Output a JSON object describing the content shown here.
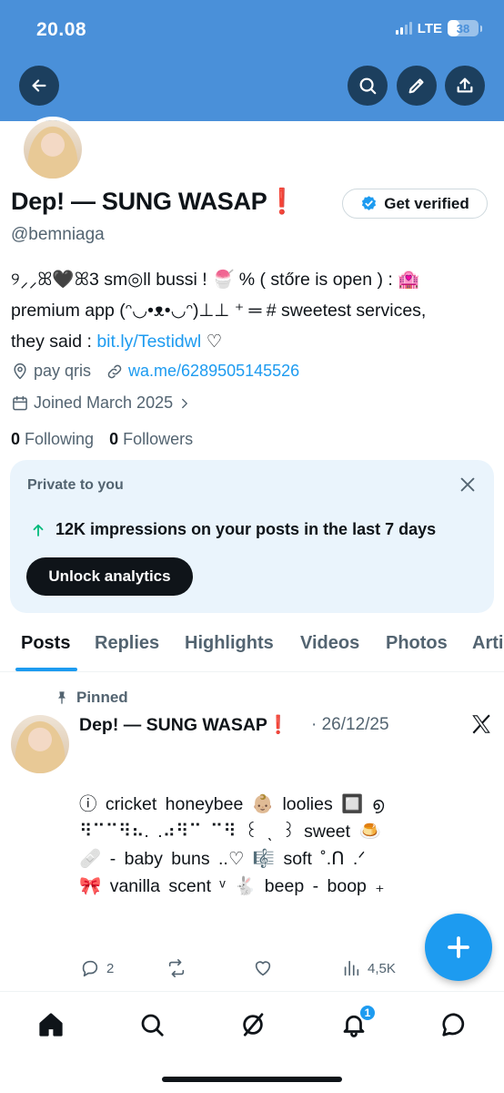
{
  "status_bar": {
    "time": "20.08",
    "network": "LTE",
    "battery_percent": "38",
    "battery_level": 0.38
  },
  "profile": {
    "display_name": "Dep! — SUNG WASAP❗",
    "handle": "@bemniaga",
    "verify_label": "Get verified",
    "bio_line1": "୨⸝⸝ꕤ🖤ꕤ3  sm◎ll bussi ! 🍧 %  ( stőre is open ) : 🏩",
    "bio_line2": "premium app (ᵔ◡•ᴥ•◡ᵔ)⊥⊥  ⁺ ═  # sweetest services,",
    "bio_line3_prefix": "they said : ",
    "bio_link": "bit.ly/Testidwl",
    "bio_line3_suffix": " ♡",
    "location": "pay qris",
    "website": "wa.me/6289505145526",
    "joined": "Joined March 2025",
    "following_count": "0",
    "following_label": "Following",
    "followers_count": "0",
    "followers_label": "Followers"
  },
  "private_card": {
    "title": "Private to you",
    "stat_text": "12K impressions on your posts in the last 7 days",
    "button_label": "Unlock analytics"
  },
  "tabs": [
    "Posts",
    "Replies",
    "Highlights",
    "Videos",
    "Photos",
    "Arti"
  ],
  "post": {
    "pinned_label": "Pinned",
    "author": "Dep! — SUNG WASAP❗",
    "date": "· 26/12/25",
    "line1": "ⓘ cricket honeybee 👶🏼 loolies 🔲 ൭",
    "line2": "⠻⠉⠉⠻⠦. .⠴⠻⠉ ⠉⠻ ꒰ ˎ ꒱ sweet 🍮",
    "line3": "🩹 - baby buns ..♡ 🎼 soft ˚.ᑎ .ᐟ",
    "line4": "🎀 vanilla scent ᵛ 🐇 beep - boop ₊",
    "replies": "2",
    "reposts": "",
    "likes": "",
    "views": "4,5K"
  },
  "bottom_nav": {
    "notification_count": "1"
  },
  "colors": {
    "banner": "#4a90d9",
    "accent": "#1d9bf0",
    "card_bg": "#eaf4fc",
    "positive": "#00ba7c"
  }
}
